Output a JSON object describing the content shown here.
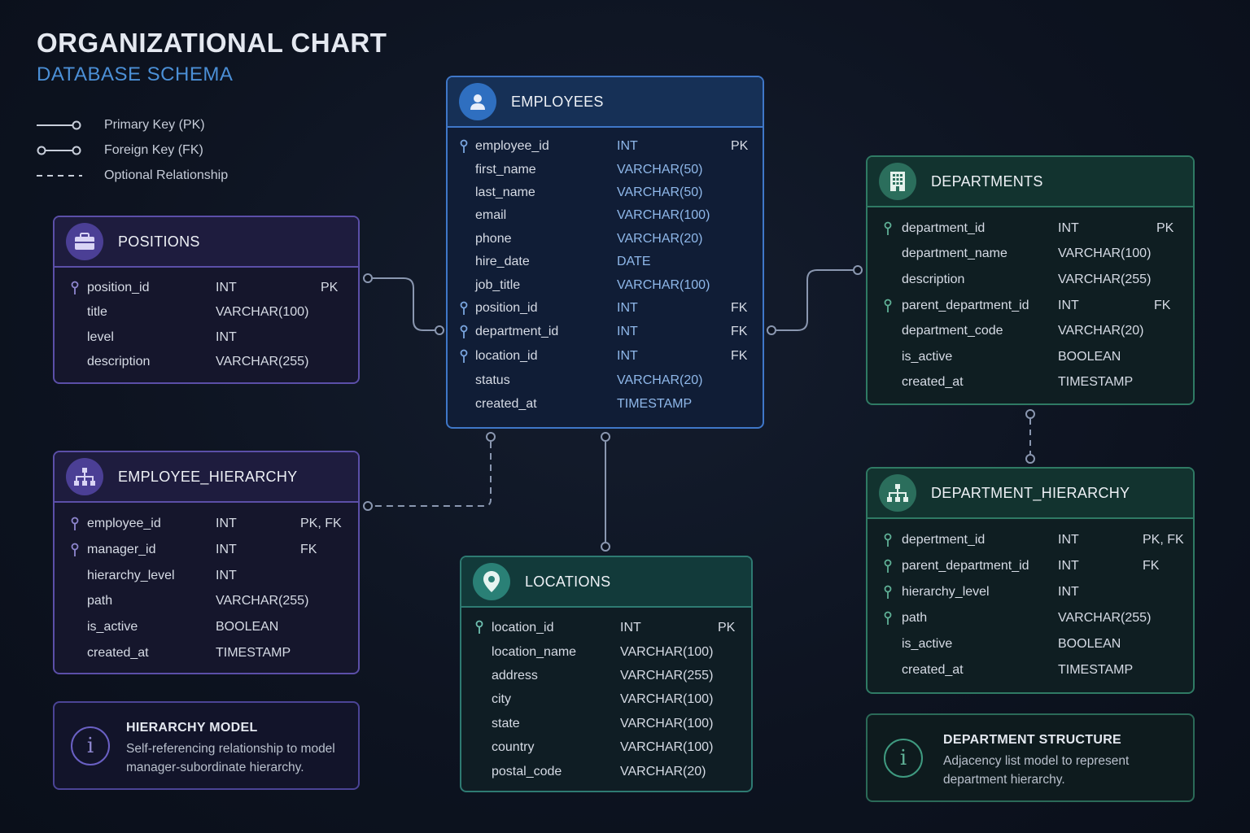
{
  "header": {
    "title": "ORGANIZATIONAL CHART",
    "subtitle": "DATABASE SCHEMA"
  },
  "legend": {
    "items": [
      {
        "label": "Primary Key (PK)",
        "icon": "line-circle-icon"
      },
      {
        "label": "Foreign Key (FK)",
        "icon": "circle-line-circle-icon"
      },
      {
        "label": "Optional Relationship",
        "icon": "dashed-line-icon"
      }
    ]
  },
  "colors": {
    "background": "#0d1320",
    "purple_accent": "#5b4fa8",
    "blue_accent": "#3f77c8",
    "green_accent": "#2f7a64",
    "teal_accent": "#2e7a72",
    "subtitle": "#4b8fd6"
  },
  "tables": {
    "employees": {
      "name": "EMPLOYEES",
      "icon": "person-icon",
      "fields": [
        {
          "name": "employee_id",
          "type": "INT",
          "key": "PK"
        },
        {
          "name": "first_name",
          "type": "VARCHAR(50)",
          "key": ""
        },
        {
          "name": "last_name",
          "type": "VARCHAR(50)",
          "key": ""
        },
        {
          "name": "email",
          "type": "VARCHAR(100)",
          "key": ""
        },
        {
          "name": "phone",
          "type": "VARCHAR(20)",
          "key": ""
        },
        {
          "name": "hire_date",
          "type": "DATE",
          "key": ""
        },
        {
          "name": "job_title",
          "type": "VARCHAR(100)",
          "key": ""
        },
        {
          "name": "position_id",
          "type": "INT",
          "key": "FK"
        },
        {
          "name": "department_id",
          "type": "INT",
          "key": "FK"
        },
        {
          "name": "location_id",
          "type": "INT",
          "key": "FK"
        },
        {
          "name": "status",
          "type": "VARCHAR(20)",
          "key": ""
        },
        {
          "name": "created_at",
          "type": "TIMESTAMP",
          "key": ""
        }
      ]
    },
    "positions": {
      "name": "POSITIONS",
      "icon": "briefcase-icon",
      "fields": [
        {
          "name": "position_id",
          "type": "INT",
          "key": "PK"
        },
        {
          "name": "title",
          "type": "VARCHAR(100)",
          "key": ""
        },
        {
          "name": "level",
          "type": "INT",
          "key": ""
        },
        {
          "name": "description",
          "type": "VARCHAR(255)",
          "key": ""
        }
      ]
    },
    "employee_hierarchy": {
      "name": "EMPLOYEE_HIERARCHY",
      "icon": "hierarchy-icon",
      "fields": [
        {
          "name": "employee_id",
          "type": "INT",
          "key": "PK, FK"
        },
        {
          "name": "manager_id",
          "type": "INT",
          "key": "FK"
        },
        {
          "name": "hierarchy_level",
          "type": "INT",
          "key": ""
        },
        {
          "name": "path",
          "type": "VARCHAR(255)",
          "key": ""
        },
        {
          "name": "is_active",
          "type": "BOOLEAN",
          "key": ""
        },
        {
          "name": "created_at",
          "type": "TIMESTAMP",
          "key": ""
        }
      ]
    },
    "departments": {
      "name": "DEPARTMENTS",
      "icon": "building-icon",
      "fields": [
        {
          "name": "department_id",
          "type": "INT",
          "key": "PK"
        },
        {
          "name": "department_name",
          "type": "VARCHAR(100)",
          "key": ""
        },
        {
          "name": "description",
          "type": "VARCHAR(255)",
          "key": ""
        },
        {
          "name": "parent_department_id",
          "type": "INT",
          "key": "FK"
        },
        {
          "name": "department_code",
          "type": "VARCHAR(20)",
          "key": ""
        },
        {
          "name": "is_active",
          "type": "BOOLEAN",
          "key": ""
        },
        {
          "name": "created_at",
          "type": "TIMESTAMP",
          "key": ""
        }
      ]
    },
    "department_hierarchy": {
      "name": "DEPARTMENT_HIERARCHY",
      "icon": "hierarchy-icon",
      "fields": [
        {
          "name": "depertment_id",
          "type": "INT",
          "key": "PK, FK"
        },
        {
          "name": "parent_department_id",
          "type": "INT",
          "key": "FK"
        },
        {
          "name": "hierarchy_level",
          "type": "INT",
          "key": ""
        },
        {
          "name": "path",
          "type": "VARCHAR(255)",
          "key": ""
        },
        {
          "name": "is_active",
          "type": "BOOLEAN",
          "key": ""
        },
        {
          "name": "created_at",
          "type": "TIMESTAMP",
          "key": ""
        }
      ]
    },
    "locations": {
      "name": "LOCATIONS",
      "icon": "map-pin-icon",
      "fields": [
        {
          "name": "location_id",
          "type": "INT",
          "key": "PK"
        },
        {
          "name": "location_name",
          "type": "VARCHAR(100)",
          "key": ""
        },
        {
          "name": "address",
          "type": "VARCHAR(255)",
          "key": ""
        },
        {
          "name": "city",
          "type": "VARCHAR(100)",
          "key": ""
        },
        {
          "name": "state",
          "type": "VARCHAR(100)",
          "key": ""
        },
        {
          "name": "country",
          "type": "VARCHAR(100)",
          "key": ""
        },
        {
          "name": "postal_code",
          "type": "VARCHAR(20)",
          "key": ""
        }
      ]
    }
  },
  "notes": {
    "hierarchy_model": {
      "title": "HIERARCHY MODEL",
      "desc": "Self-referencing relationship to model manager-subordinate hierarchy.",
      "icon": "info-icon"
    },
    "department_structure": {
      "title": "DEPARTMENT STRUCTURE",
      "desc": "Adjacency list model to represent department hierarchy.",
      "icon": "info-icon"
    }
  }
}
